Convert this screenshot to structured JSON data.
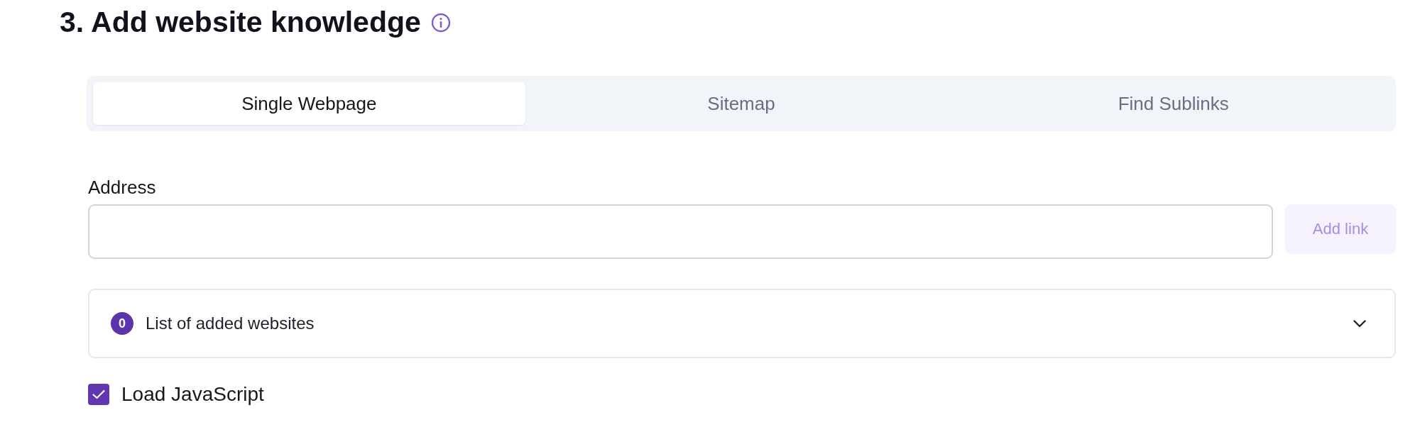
{
  "heading": {
    "title": "3. Add website knowledge"
  },
  "tabs": [
    {
      "label": "Single Webpage",
      "selected": true
    },
    {
      "label": "Sitemap",
      "selected": false
    },
    {
      "label": "Find Sublinks",
      "selected": false
    }
  ],
  "address": {
    "label": "Address",
    "button": {
      "label": "Add link",
      "disabled": true
    }
  },
  "websites_list": {
    "count": "0",
    "label": "List of added websites",
    "expanded": false
  },
  "options": [
    {
      "label": "Load JavaScript",
      "checked": true
    }
  ]
}
